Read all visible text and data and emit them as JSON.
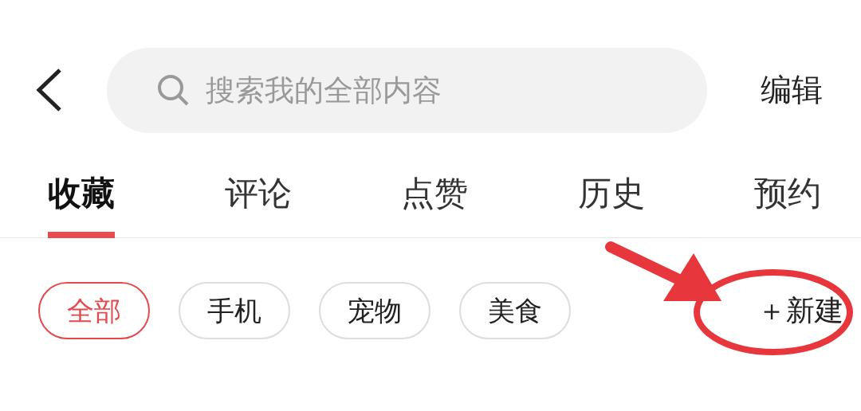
{
  "search": {
    "placeholder": "搜索我的全部内容"
  },
  "edit_button": "编辑",
  "tabs": [
    {
      "label": "收藏",
      "selected": true
    },
    {
      "label": "评论",
      "selected": false
    },
    {
      "label": "点赞",
      "selected": false
    },
    {
      "label": "历史",
      "selected": false
    },
    {
      "label": "预约",
      "selected": false
    }
  ],
  "filters": [
    {
      "label": "全部",
      "selected": true
    },
    {
      "label": "手机",
      "selected": false
    },
    {
      "label": "宠物",
      "selected": false
    },
    {
      "label": "美食",
      "selected": false
    }
  ],
  "new_button": "＋新建"
}
